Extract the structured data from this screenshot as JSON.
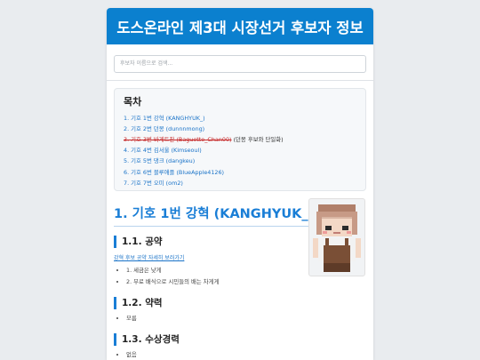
{
  "header": {
    "title": "도스온라인 제3대 시장선거 후보자 정보"
  },
  "search": {
    "placeholder": "후보자 이름으로 검색..."
  },
  "toc": {
    "title": "목차",
    "items": [
      {
        "label": "1. 기호 1번 강혁 (KANGHYUK_)",
        "struck": false,
        "note": ""
      },
      {
        "label": "2. 기호 2번 던몽 (dunnnmong)",
        "struck": false,
        "note": ""
      },
      {
        "label": "3. 기호 3번 바게트찬 (Baguette_Chan00)",
        "struck": true,
        "note": " (던몽 후보와 단일화)"
      },
      {
        "label": "4. 기호 4번 김서울 (Kimseoul)",
        "struck": false,
        "note": ""
      },
      {
        "label": "5. 기호 5번 댕크 (dangkeu)",
        "struck": false,
        "note": ""
      },
      {
        "label": "6. 기호 6번 블루애플 (BlueApple4126)",
        "struck": false,
        "note": ""
      },
      {
        "label": "7. 기호 7번 오미 (om2)",
        "struck": false,
        "note": ""
      }
    ]
  },
  "section": {
    "title": "1. 기호 1번 강혁 (KANGHYUK_)",
    "pledges": {
      "heading": "1.1. 공약",
      "detail_link": "강혁 후보 공약 자세히 보러가기",
      "items": [
        "1. 세금은 낮게",
        "2. 무료 배식으로 시민들의 배는 차게게"
      ]
    },
    "weakness": {
      "heading": "1.2. 약력",
      "items": [
        "모름"
      ]
    },
    "awards": {
      "heading": "1.3. 수상경력",
      "items": [
        "없음"
      ]
    }
  },
  "colors": {
    "header_bg": "#0b80cf",
    "accent": "#1a7ed6",
    "link": "#1a73c8",
    "struck": "#c62828"
  }
}
